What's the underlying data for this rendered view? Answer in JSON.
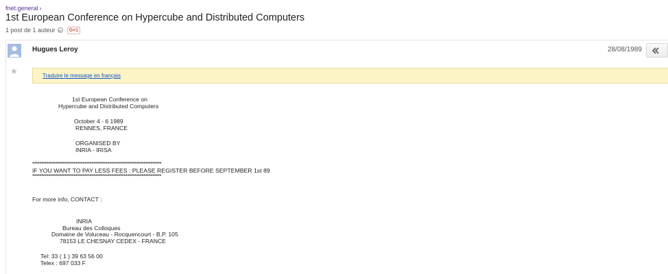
{
  "breadcrumb": {
    "group": "fnet.general",
    "separator": "›"
  },
  "thread": {
    "title": "1st European Conference on Hypercube and Distributed Computers",
    "meta": "1 post de 1 auteur",
    "gplus_label": "G+1"
  },
  "post": {
    "author": "Hugues Leroy",
    "date": "28/08/1989",
    "star_glyph": "★",
    "translate_link": "Traduire le message en français",
    "body": {
      "conf_line1": "1st European Conference on",
      "conf_line2": "Hypercube and Distributed Computers",
      "dates": "October 4 - 6 1989",
      "location": "RENNES, FRANCE",
      "organised_by": "ORGANISED BY",
      "organisers": "INRIA - IRISA",
      "stars_top": "************************************************************************",
      "fees_notice": "IF YOU WANT TO PAY LESS FEES : PLEASE REGISTER BEFORE SEPTEMBER 1st 89",
      "stars_bottom": "************************************************************************",
      "more_info": "For more info, CONTACT :",
      "contact_org": "INRIA",
      "contact_dept": "Bureau des Colloques",
      "contact_addr1": "Domaine de Voluceau - Rocquencourt - B.P. 105",
      "contact_addr2": "78153 LE CHESNAY CEDEX - FRANCE",
      "tel": "Tel: 33 ( 1 ) 39 63 56 00",
      "telex": "Telex : 697 033 F"
    }
  },
  "colors": {
    "breadcrumb_link": "#5a2f9b",
    "avatar_bg": "#a4bce2",
    "translate_bar_bg": "#fdf4c6",
    "link": "#1155cc",
    "gplus": "#dd4b39"
  },
  "icons": {
    "reply": "reply-icon",
    "dropdown": "chevron-down-icon",
    "star": "star-icon",
    "avatar": "avatar-icon"
  }
}
